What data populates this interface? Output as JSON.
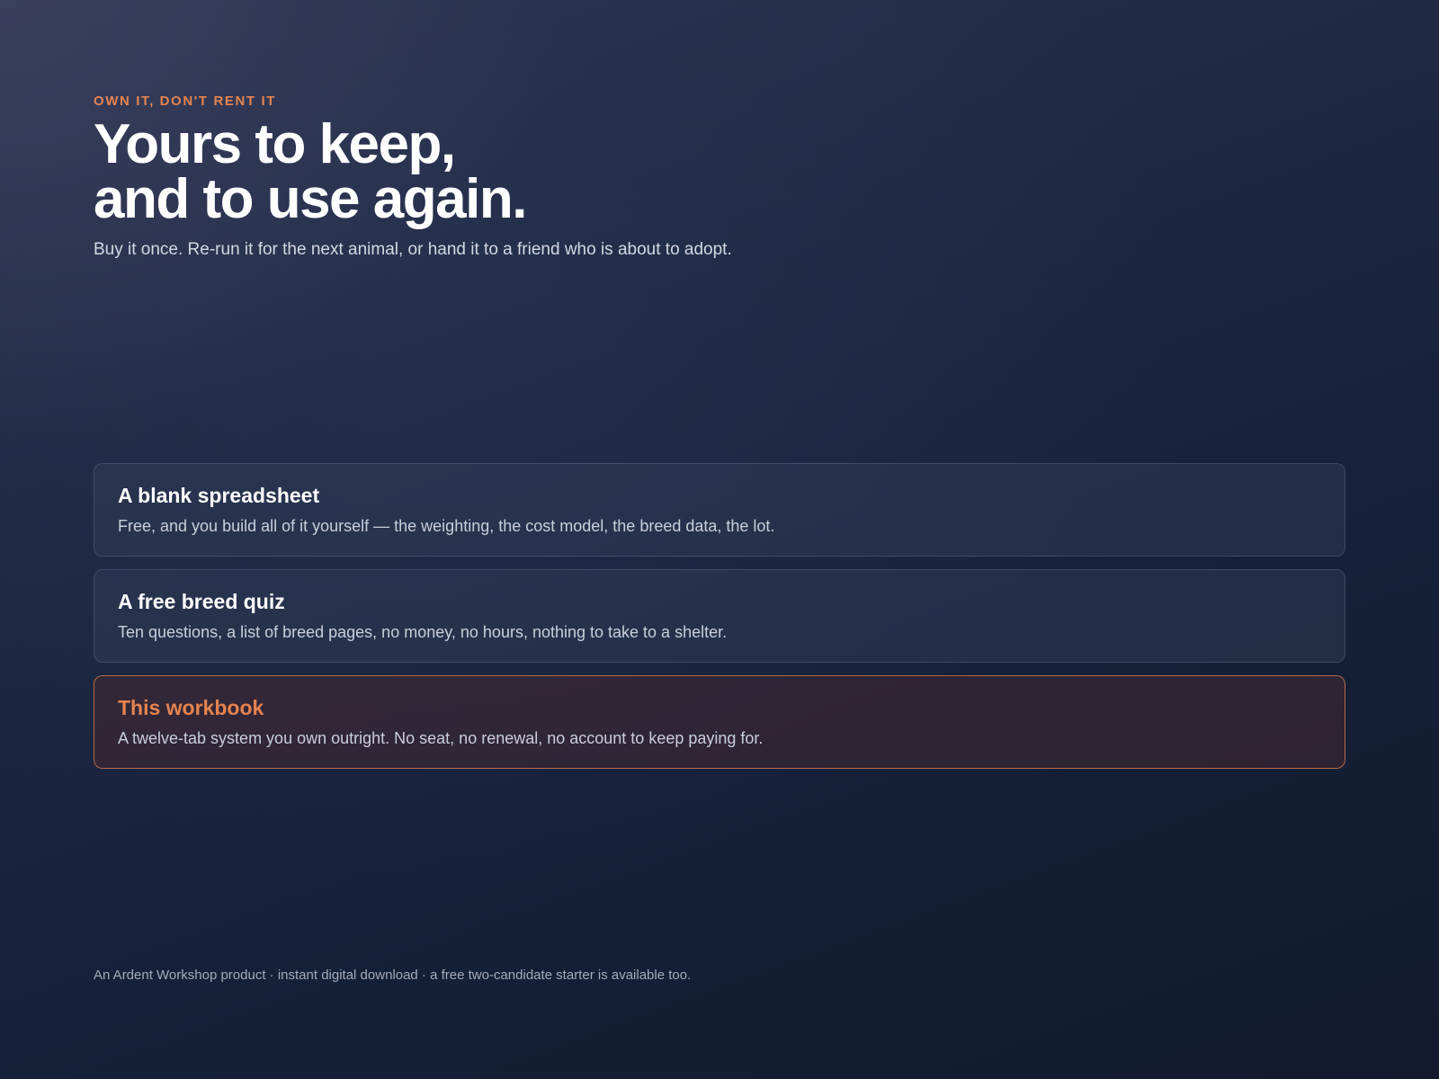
{
  "hero": {
    "eyebrow": "OWN IT, DON'T RENT IT",
    "headline_line1": "Yours to keep,",
    "headline_line2": "and to use again.",
    "subhead": "Buy it once. Re-run it for the next animal, or hand it to a friend who is about to adopt."
  },
  "comparison": {
    "items": [
      {
        "title": "A blank spreadsheet",
        "description": "Free, and you build all of it yourself — the weighting, the cost model, the breed data, the lot.",
        "highlighted": false
      },
      {
        "title": "A free breed quiz",
        "description": "Ten questions, a list of breed pages, no money, no hours, nothing to take to a shelter.",
        "highlighted": false
      },
      {
        "title": "This workbook",
        "description": "A twelve-tab system you own outright. No seat, no renewal, no account to keep paying for.",
        "highlighted": true
      }
    ]
  },
  "footer": {
    "text": "An Ardent Workshop product · instant digital download · a free two-candidate starter is available too."
  },
  "colors": {
    "accent": "#e5834f",
    "background_dark": "#111a2d",
    "background_light": "#2e3550",
    "text_primary": "#ffffff",
    "text_secondary": "#c9cfdb"
  }
}
